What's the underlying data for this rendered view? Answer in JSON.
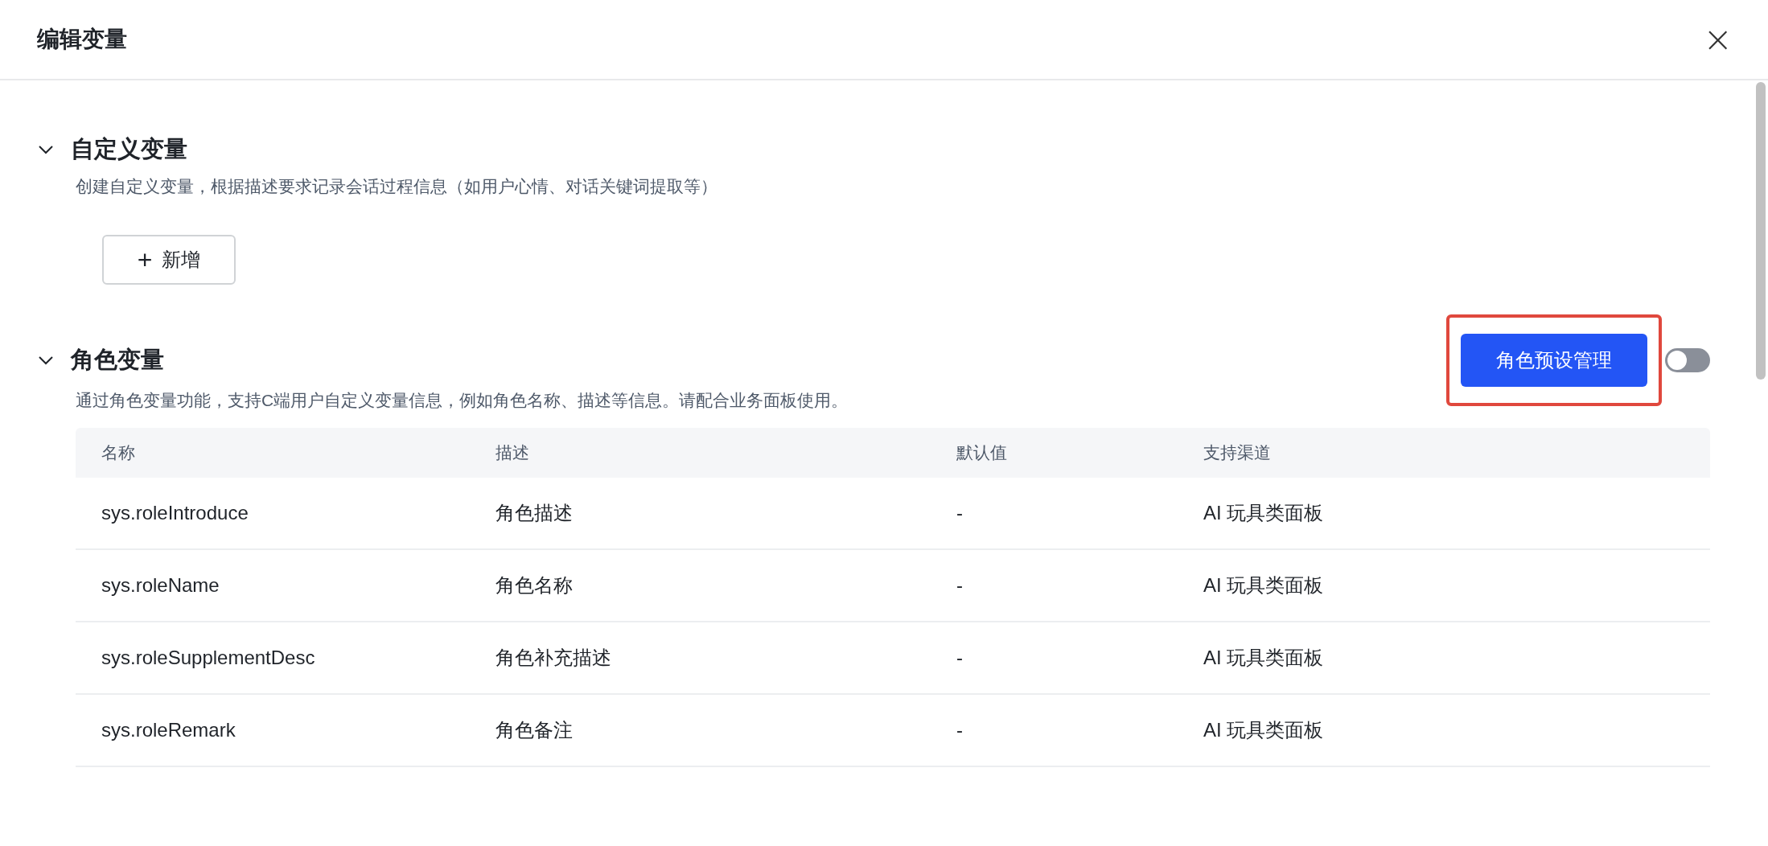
{
  "dialog": {
    "title": "编辑变量",
    "close_label": "×"
  },
  "sections": [
    {
      "title": "自定义变量",
      "expanded": true,
      "description": "创建自定义变量，根据描述要求记录会话过程信息（如用户心情、对话关键词提取等）",
      "add_button": {
        "icon": "+",
        "label": "新增"
      }
    },
    {
      "title": "角色变量",
      "expanded": true,
      "description": "通过角色变量功能，支持C端用户自定义变量信息，例如角色名称、描述等信息。请配合业务面板使用。",
      "preset_button": {
        "label": "角色预设管理",
        "highlighted": true
      },
      "toggle": {
        "on": false
      },
      "table": {
        "columns": [
          "名称",
          "描述",
          "默认值",
          "支持渠道"
        ],
        "rows": [
          [
            "sys.roleIntroduce",
            "角色描述",
            "-",
            "AI 玩具类面板"
          ],
          [
            "sys.roleName",
            "角色名称",
            "-",
            "AI 玩具类面板"
          ],
          [
            "sys.roleSupplementDesc",
            "角色补充描述",
            "-",
            "AI 玩具类面板"
          ],
          [
            "sys.roleRemark",
            "角色备注",
            "-",
            "AI 玩具类面板"
          ]
        ]
      }
    }
  ]
}
